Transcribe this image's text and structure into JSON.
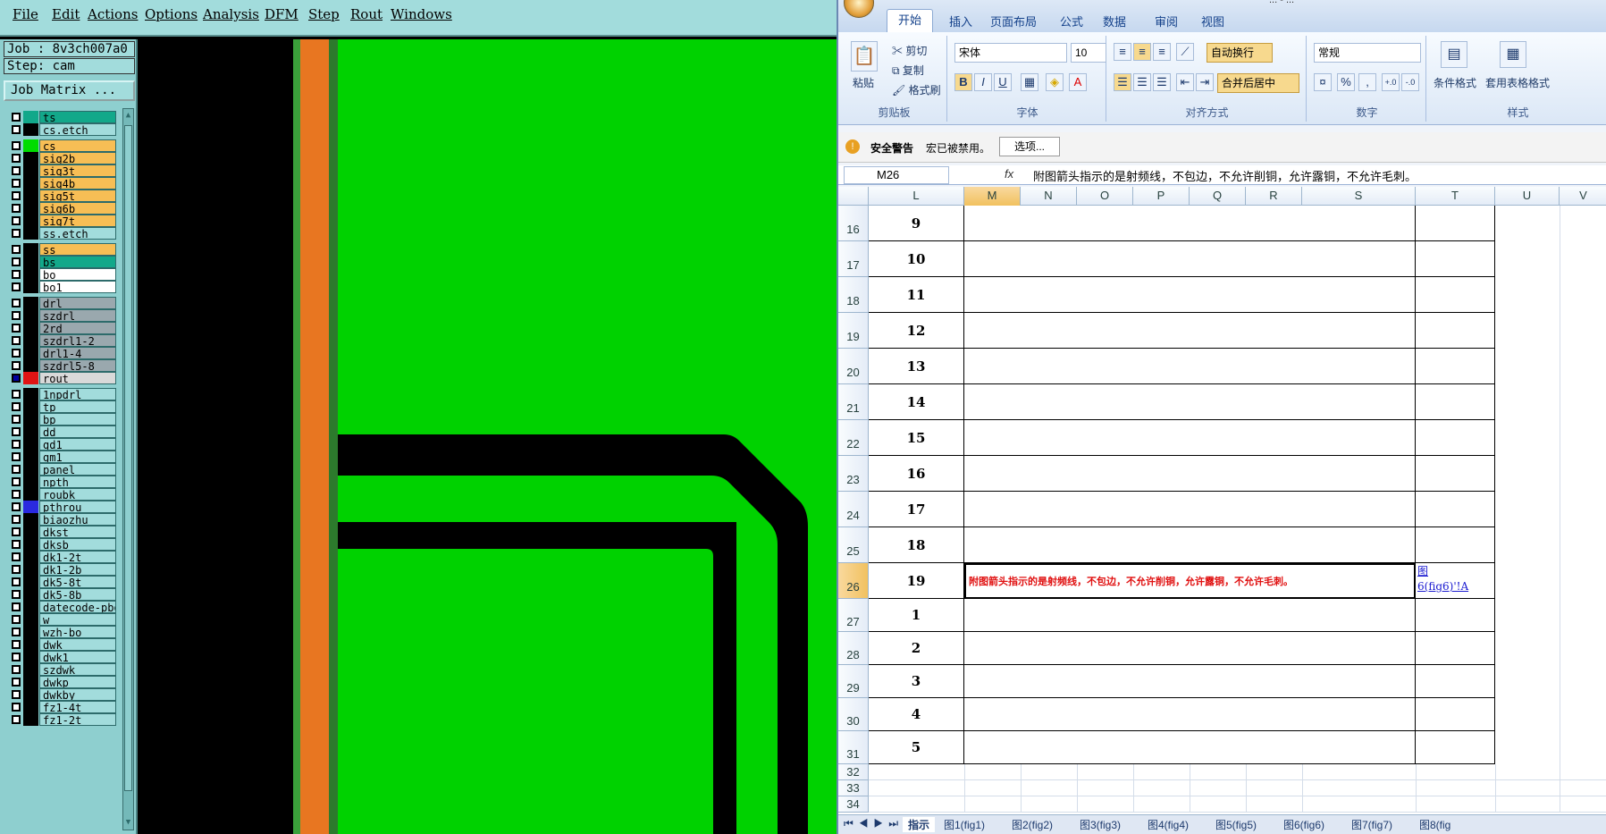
{
  "cam": {
    "menu": [
      "File",
      "Edit",
      "Actions",
      "Options",
      "Analysis",
      "DFM",
      "Step",
      "Rout",
      "Windows"
    ],
    "job_label": "Job : 8v3ch007a0",
    "step_label": "Step: cam",
    "job_matrix_button": "Job Matrix ...",
    "layers": [
      {
        "name": "ts",
        "color": "#12a88a",
        "swatch": "#12a88a"
      },
      {
        "name": "cs.etch",
        "color": "#a2dcdc",
        "swatch": "#000000"
      },
      {
        "name": "cs",
        "color": "#f7be55",
        "swatch": "#00dc00"
      },
      {
        "name": "sig2b",
        "color": "#f7be55",
        "swatch": "#000000"
      },
      {
        "name": "sig3t",
        "color": "#f7be55",
        "swatch": "#000000"
      },
      {
        "name": "sig4b",
        "color": "#f7be55",
        "swatch": "#000000"
      },
      {
        "name": "sig5t",
        "color": "#f7be55",
        "swatch": "#000000"
      },
      {
        "name": "sig6b",
        "color": "#f7be55",
        "swatch": "#000000"
      },
      {
        "name": "sig7t",
        "color": "#f7be55",
        "swatch": "#000000"
      },
      {
        "name": "ss.etch",
        "color": "#a2dcdc",
        "swatch": "#000000"
      },
      {
        "name": "ss",
        "color": "#f7be55",
        "swatch": "#000000"
      },
      {
        "name": "bs",
        "color": "#12a88a",
        "swatch": "#000000"
      },
      {
        "name": "bo",
        "color": "#ffffff",
        "swatch": "#000000"
      },
      {
        "name": "bo1",
        "color": "#ffffff",
        "swatch": "#000000"
      },
      {
        "name": "drl",
        "color": "#9aa8ae",
        "swatch": "#000000"
      },
      {
        "name": "szdrl",
        "color": "#9aa8ae",
        "swatch": "#000000"
      },
      {
        "name": "2rd",
        "color": "#9aa8ae",
        "swatch": "#000000"
      },
      {
        "name": "szdrl1-2",
        "color": "#9aa8ae",
        "swatch": "#000000"
      },
      {
        "name": "drl1-4",
        "color": "#9aa8ae",
        "swatch": "#000000"
      },
      {
        "name": "szdrl5-8",
        "color": "#9aa8ae",
        "swatch": "#000000"
      },
      {
        "name": "rout",
        "color": "#d9d9d9",
        "swatch": "#e01414"
      },
      {
        "name": "1npdrl",
        "color": "#a2dcdc",
        "swatch": "#000000"
      },
      {
        "name": "tp",
        "color": "#a2dcdc",
        "swatch": "#000000"
      },
      {
        "name": "bp",
        "color": "#a2dcdc",
        "swatch": "#000000"
      },
      {
        "name": "dd",
        "color": "#a2dcdc",
        "swatch": "#000000"
      },
      {
        "name": "gd1",
        "color": "#a2dcdc",
        "swatch": "#000000"
      },
      {
        "name": "gm1",
        "color": "#a2dcdc",
        "swatch": "#000000"
      },
      {
        "name": "panel",
        "color": "#a2dcdc",
        "swatch": "#000000"
      },
      {
        "name": "npth",
        "color": "#a2dcdc",
        "swatch": "#000000"
      },
      {
        "name": "roubk",
        "color": "#a2dcdc",
        "swatch": "#000000"
      },
      {
        "name": "pthrou",
        "color": "#a2dcdc",
        "swatch": "#2a2ae0"
      },
      {
        "name": "biaozhu",
        "color": "#a2dcdc",
        "swatch": "#000000"
      },
      {
        "name": "dkst",
        "color": "#a2dcdc",
        "swatch": "#000000"
      },
      {
        "name": "dksb",
        "color": "#a2dcdc",
        "swatch": "#000000"
      },
      {
        "name": "dk1-2t",
        "color": "#a2dcdc",
        "swatch": "#000000"
      },
      {
        "name": "dk1-2b",
        "color": "#a2dcdc",
        "swatch": "#000000"
      },
      {
        "name": "dk5-8t",
        "color": "#a2dcdc",
        "swatch": "#000000"
      },
      {
        "name": "dk5-8b",
        "color": "#a2dcdc",
        "swatch": "#000000"
      },
      {
        "name": "datecode-pbo",
        "color": "#a2dcdc",
        "swatch": "#000000"
      },
      {
        "name": "w",
        "color": "#a2dcdc",
        "swatch": "#000000"
      },
      {
        "name": "wzh-bo",
        "color": "#a2dcdc",
        "swatch": "#000000"
      },
      {
        "name": "dwk",
        "color": "#a2dcdc",
        "swatch": "#000000"
      },
      {
        "name": "dwk1",
        "color": "#a2dcdc",
        "swatch": "#000000"
      },
      {
        "name": "szdwk",
        "color": "#a2dcdc",
        "swatch": "#000000"
      },
      {
        "name": "dwkp",
        "color": "#a2dcdc",
        "swatch": "#000000"
      },
      {
        "name": "dwkby",
        "color": "#a2dcdc",
        "swatch": "#000000"
      },
      {
        "name": "fz1-4t",
        "color": "#a2dcdc",
        "swatch": "#000000"
      },
      {
        "name": "fz1-2t",
        "color": "#a2dcdc",
        "swatch": "#000000"
      }
    ]
  },
  "excel": {
    "title_fragment": "... - ...",
    "tabs": [
      "开始",
      "插入",
      "页面布局",
      "公式",
      "数据",
      "审阅",
      "视图"
    ],
    "clipboard": {
      "paste": "粘贴",
      "cut": "剪切",
      "copy": "复制",
      "format_painter": "格式刷",
      "label": "剪贴板"
    },
    "font": {
      "name": "宋体",
      "size": "10",
      "label": "字体"
    },
    "alignment": {
      "wrap": "自动换行",
      "merge": "合并后居中",
      "label": "对齐方式"
    },
    "number": {
      "format": "常规",
      "label": "数字"
    },
    "styles": {
      "conditional": "条件格式",
      "table": "套用表格格式",
      "label": "样式"
    },
    "security": {
      "title": "安全警告",
      "message": "宏已被禁用。",
      "options_button": "选项..."
    },
    "name_box": "M26",
    "fx": "fx",
    "formula": "附图箭头指示的是射频线，不包边，不允许削铜，允许露铜，不允许毛刺。",
    "columns": [
      "L",
      "M",
      "N",
      "O",
      "P",
      "Q",
      "R",
      "S",
      "T",
      "U",
      "V"
    ],
    "rows": [
      {
        "row": "16",
        "num": "9"
      },
      {
        "row": "17",
        "num": "10"
      },
      {
        "row": "18",
        "num": "11"
      },
      {
        "row": "19",
        "num": "12"
      },
      {
        "row": "20",
        "num": "13"
      },
      {
        "row": "21",
        "num": "14"
      },
      {
        "row": "22",
        "num": "15"
      },
      {
        "row": "23",
        "num": "16"
      },
      {
        "row": "24",
        "num": "17"
      },
      {
        "row": "25",
        "num": "18"
      },
      {
        "row": "26",
        "num": "19",
        "text": "附图箭头指示的是射频线，不包边，不允许削铜，允许露铜，不允许毛刺。",
        "link_line1": "图",
        "link_line2": "6(fig6)'!A"
      },
      {
        "row": "27",
        "num": "1"
      },
      {
        "row": "28",
        "num": "2"
      },
      {
        "row": "29",
        "num": "3"
      },
      {
        "row": "30",
        "num": "4"
      },
      {
        "row": "31",
        "num": "5"
      },
      {
        "row": "32",
        "num": ""
      },
      {
        "row": "33",
        "num": ""
      },
      {
        "row": "34",
        "num": ""
      }
    ],
    "sheet_tabs": [
      "指示",
      "图1(fig1)",
      "图2(fig2)",
      "图3(fig3)",
      "图4(fig4)",
      "图5(fig5)",
      "图6(fig6)",
      "图7(fig7)",
      "图8(fig"
    ]
  }
}
